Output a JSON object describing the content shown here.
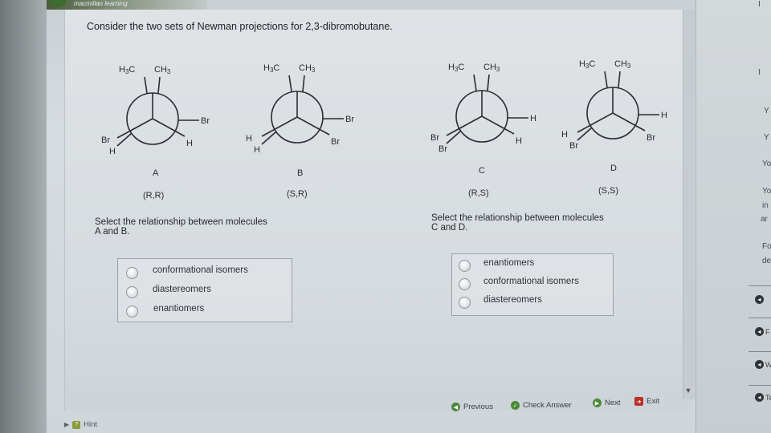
{
  "app": {
    "brand_label": "macmillan learning"
  },
  "question": {
    "text": "Consider the two sets of Newman projections for 2,3-dibromobutane."
  },
  "molecules": [
    {
      "letter": "A",
      "config": "(R,R)",
      "front_left": "Br",
      "front_right": "H",
      "back_top_left": "H3C",
      "back_top_right": "CH3",
      "back_right": "Br",
      "back_bottom_left": "H"
    },
    {
      "letter": "B",
      "config": "(S,R)",
      "front_left": "H",
      "front_right": "Br",
      "back_top_left": "H3C",
      "back_top_right": "CH3",
      "back_right": "Br",
      "back_bottom_left": "H"
    },
    {
      "letter": "C",
      "config": "(R,S)",
      "front_left": "Br",
      "front_right": "H",
      "back_top_left": "H3C",
      "back_top_right": "CH3",
      "back_right": "H",
      "back_bottom_left": "Br"
    },
    {
      "letter": "D",
      "config": "(S,S)",
      "front_left": "H",
      "front_right": "Br",
      "back_top_left": "H3C",
      "back_top_right": "CH3",
      "back_right": "H",
      "back_bottom_left": "Br"
    }
  ],
  "part1": {
    "prompt_line1": "Select the relationship between molecules",
    "prompt_line2": "A and B.",
    "options": [
      "conformational isomers",
      "diastereomers",
      "enantiomers"
    ]
  },
  "part2": {
    "prompt_line1": "Select the relationship between molecules",
    "prompt_line2": "C and D.",
    "options": [
      "enantiomers",
      "conformational isomers",
      "diastereomers"
    ]
  },
  "nav": {
    "previous": "Previous",
    "check_answer": "Check Answer",
    "next": "Next",
    "exit": "Exit"
  },
  "hint": "Hint",
  "right_panel": {
    "fragments": [
      "Y",
      "Y",
      "Yo",
      "Yo",
      "in",
      "ar",
      "Fo",
      "de"
    ],
    "item_letters": [
      "I",
      "I"
    ],
    "item_labels": [
      "",
      "F",
      "W",
      "Te"
    ]
  },
  "colors": {
    "check_green": "#4a8a3a",
    "exit_red": "#b8322a"
  }
}
